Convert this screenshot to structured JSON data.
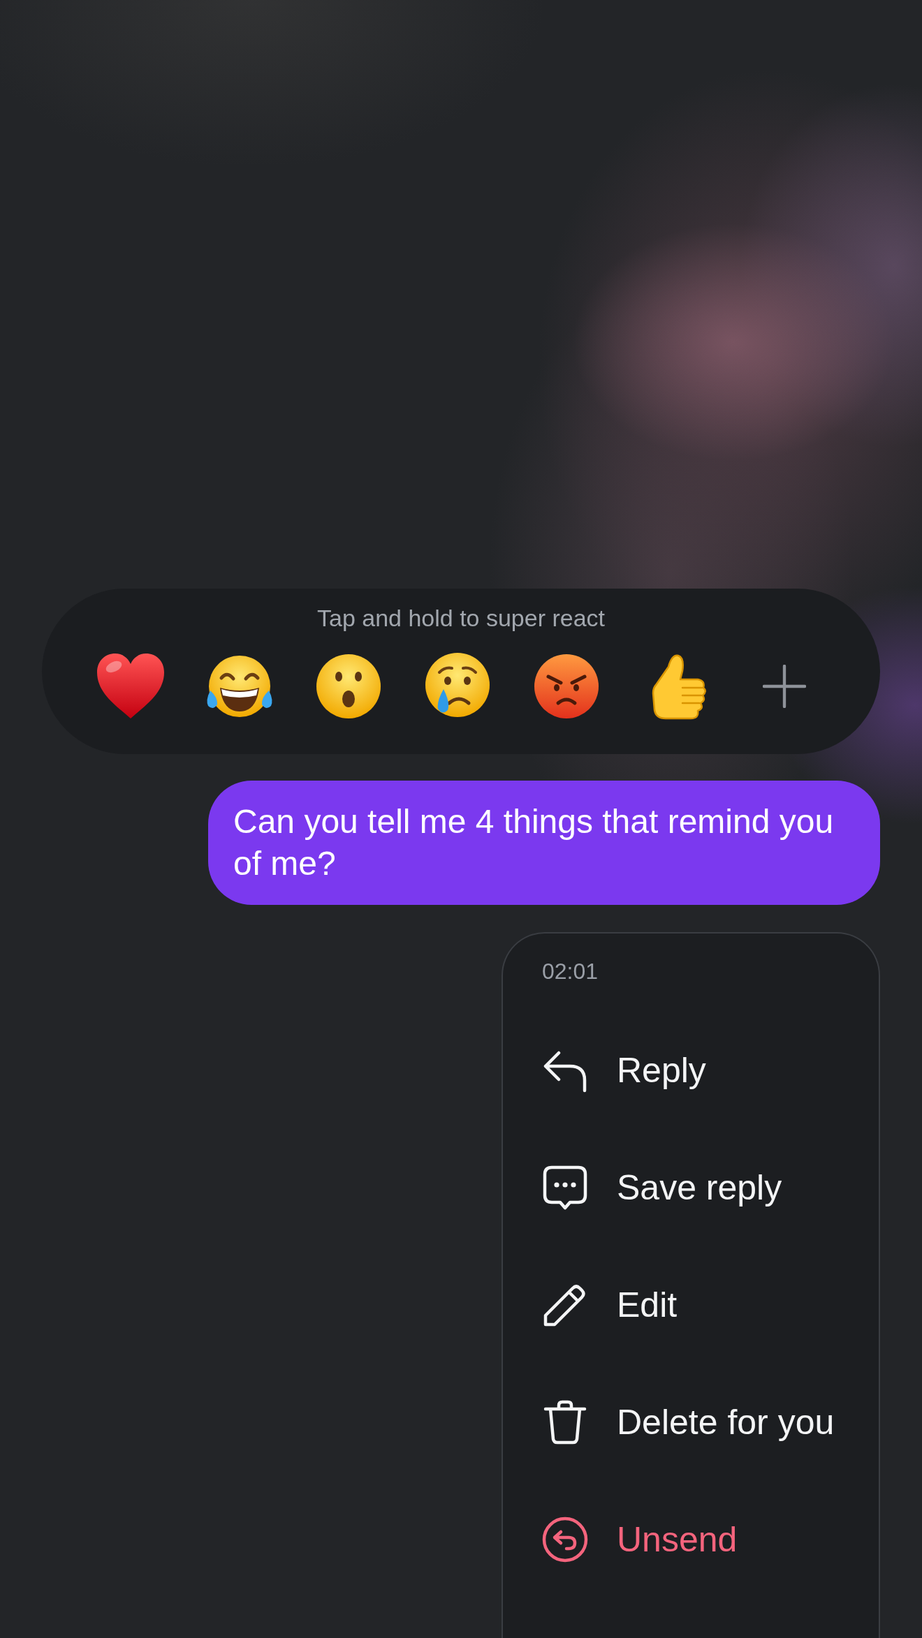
{
  "reaction_bar": {
    "hint": "Tap and hold to super react"
  },
  "message": {
    "text": "Can you tell me 4 things that remind you of me?"
  },
  "menu": {
    "time": "02:01",
    "items": [
      {
        "kind": "reply",
        "label": "Reply",
        "destructive": false
      },
      {
        "kind": "save",
        "label": "Save reply",
        "destructive": false
      },
      {
        "kind": "edit",
        "label": "Edit",
        "destructive": false
      },
      {
        "kind": "delete",
        "label": "Delete for you",
        "destructive": false
      },
      {
        "kind": "unsend",
        "label": "Unsend",
        "destructive": true
      }
    ]
  }
}
